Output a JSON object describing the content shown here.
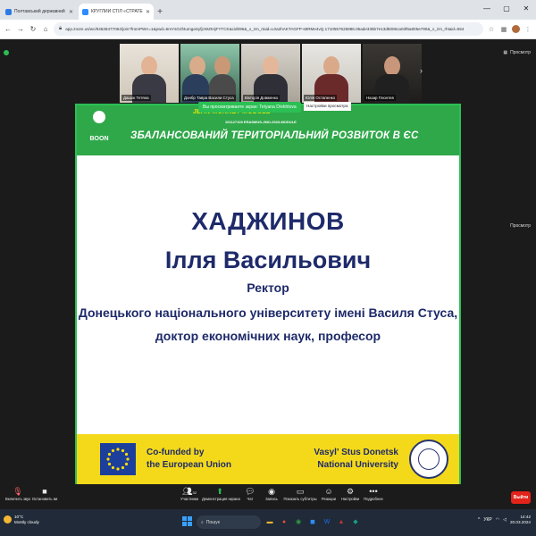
{
  "browser": {
    "tabs": [
      {
        "title": "Полтавський державний агр",
        "active": false
      },
      {
        "title": "КРУГЛИЙ СТІЛ «СТРАТЕГ",
        "active": true
      }
    ],
    "url": "app.zoom.us/wc/84628477064/join?fromPWA=1&pwd=5mYsG2f4umgaSyfjcWZIHjFYTCK&cid096&_x_zm_rtaid=L0a2hAKTAGFP-s8RMe4vQ.1710557625986.05ade335b7e13d8006ca03f6a805e790&_x_zm_rhtaid=554"
  },
  "zoom": {
    "encryption_label": "",
    "view_label": "Просмотр",
    "participants": [
      {
        "name": "Дашок Тетяна"
      },
      {
        "name": "Донбр Тавра Васили Стуса"
      },
      {
        "name": "Вікторія Довженко"
      },
      {
        "name": "Юлія Остапенко"
      },
      {
        "name": "Назар Глюнтев"
      }
    ],
    "viewing_banner": "Вы просматриваете экран: Tetyana D/ekhtova",
    "view_options": "Параметры просмотра",
    "settings_tip": "Настройки просмотра",
    "side_view": "Просмотр",
    "toolbar": {
      "mute": "Включить звук",
      "video": "Остановить ви",
      "participants": "Участники",
      "participants_count": "32",
      "share": "Демонстрация экрана",
      "chat": "Чат",
      "record": "Запись",
      "captions": "Показать субтитры",
      "reactions": "Реакции",
      "settings": "Настройки",
      "more": "Подробнее",
      "leave": "Выйти"
    }
  },
  "slide": {
    "logo_text": "BOON",
    "program": "JEAN MONNET MODULE",
    "project_id": "101127100 ERASMUS-JMO-2023-MODULE",
    "title": "ЗБАЛАНСОВАНИЙ ТЕРИТОРІАЛЬНИЙ РОЗВИТОК В ЄС",
    "surname": "ХАДЖИНОВ",
    "given_names": "Ілля Васильович",
    "role": "Ректор",
    "university": "Донецького національного університету імені Василя Стуса,",
    "degree": "доктор економічних наук, професор",
    "footer_left_1": "Co-funded by",
    "footer_left_2": "the European Union",
    "footer_right_1": "Vasyl' Stus Donetsk",
    "footer_right_2": "National University",
    "colors": {
      "green": "#2fa84a",
      "yellow": "#f4d91a",
      "navy": "#1e2a6a"
    }
  },
  "taskbar": {
    "weather_temp": "10°C",
    "weather_desc": "Mostly cloudy",
    "search_placeholder": "Пошук",
    "lang": "УКР",
    "time": "14:42",
    "date": "20.03.2024"
  }
}
